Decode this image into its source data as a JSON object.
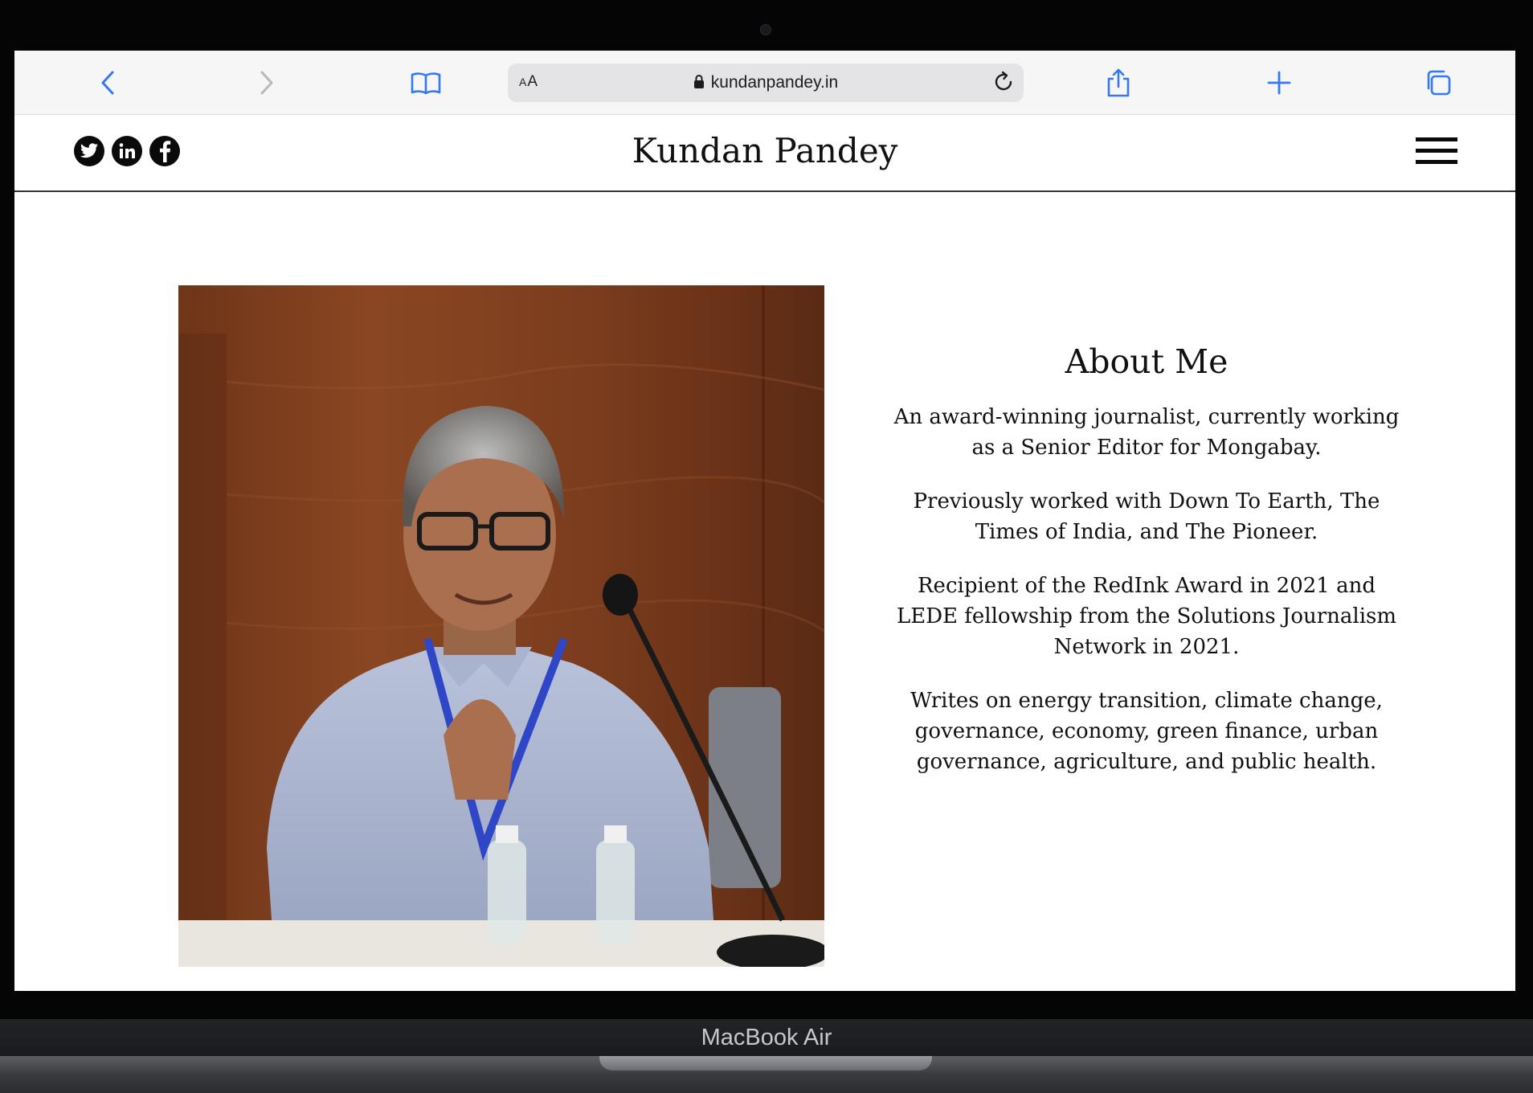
{
  "browser": {
    "text_size_label": "AA",
    "url": "kundanpandey.in"
  },
  "site": {
    "title": "Kundan Pandey",
    "social_links": [
      "twitter",
      "linkedin",
      "facebook"
    ]
  },
  "about": {
    "heading": "About Me",
    "paragraphs": [
      "An award-winning journalist, currently working as a Senior Editor for Mongabay.",
      "Previously worked with Down To Earth, The Times of India, and The Pioneer.",
      "Recipient of the RedInk Award in 2021 and LEDE fellowship from the Solutions Journalism Network in 2021.",
      "Writes on energy transition, climate change, governance, economy, green finance, urban governance, agriculture, and public health."
    ]
  },
  "device": {
    "label": "MacBook Air"
  },
  "colors": {
    "safari_blue": "#3478f6",
    "toolbar_bg": "#f6f6f6",
    "address_bg": "#e4e4e6",
    "text": "#111111"
  }
}
